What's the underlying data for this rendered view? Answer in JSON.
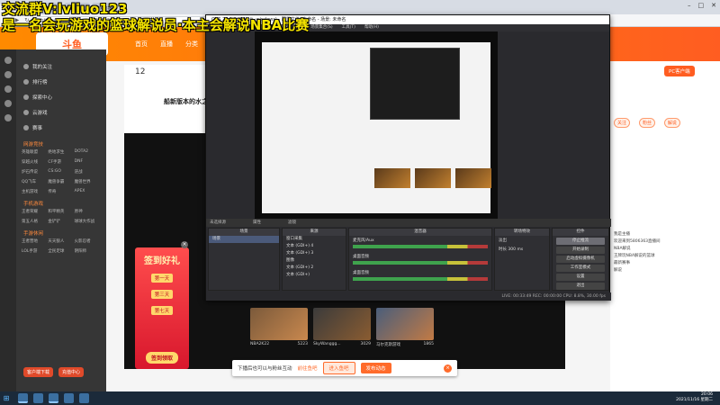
{
  "browser": {
    "tabs": [
      "斗鱼直播",
      "OBS 26.1.1 (64-bit, windows) - 配置文件: 未命名 - 场景: 未命名",
      "NBA2K22",
      "2K篮球",
      "2K直播"
    ],
    "url": "https://www.douyu.com/5806363"
  },
  "overlay": {
    "line1": "交流群V:lvliuo123",
    "line2": "是一名会玩游戏的篮球解说员·本主会解说NBA比赛"
  },
  "header": {
    "logo": "斗鱼",
    "nav": [
      "首页",
      "直播",
      "分类",
      "游戏",
      "鱼吧"
    ],
    "pc_button": "PC客户端"
  },
  "sidebar": {
    "items": [
      "我的关注",
      "排行榜",
      "探索中心",
      "云游戏",
      "赛事"
    ],
    "sec_hot": "网游竞技",
    "hot_games": [
      "英雄联盟",
      "绝地求生",
      "DOTA2",
      "穿越火线",
      "CF手游",
      "DNF",
      "炉石传说",
      "CS:GO",
      "逆战",
      "QQ飞车",
      "魔兽争霸",
      "魔兽世界",
      "主机游戏",
      "传奇",
      "APEX"
    ],
    "sec_mobile": "手机游戏",
    "mobile_games": [
      "王者荣耀",
      "和平精英",
      "原神",
      "第五人格",
      "金铲铲",
      "球球大作战"
    ],
    "sec_fun": "手游休闲",
    "fun_games": [
      "王者营地",
      "天天狼人",
      "火影忍者",
      "LOL手游",
      "全民足球",
      "阴阳师"
    ],
    "btn_client": "客户端下载",
    "btn_recharge": "充值中心"
  },
  "room": {
    "fans": "12",
    "name": "船新版本的水之"
  },
  "promo": {
    "title": "签到好礼",
    "day1": "第一天",
    "day2": "第三天",
    "day3": "第七天",
    "button": "签到领取",
    "close": "×"
  },
  "thumbs": [
    {
      "title": "NBA2K22",
      "views": "5223"
    },
    {
      "title": "SkyWanggg...",
      "views": "3029"
    },
    {
      "title": "马尔克斯游戏",
      "views": "1865"
    }
  ],
  "toast": {
    "text": "下播后也可以与粉丝互动",
    "link": "前往鱼吧",
    "btn1": "进入鱼吧",
    "btn2": "发布动态",
    "close": "×"
  },
  "right_panel": {
    "lines": [
      "我是主播",
      "欢迎来到5806363直播间",
      "NBA解说",
      "王牌玩NBA解说的篮球",
      "最新赛事",
      "解说"
    ],
    "btns": [
      "关注",
      "粉丝",
      "解说"
    ]
  },
  "obs": {
    "title": "OBS 26.1.1 (64-bit, windows) - 配置文件: 未命名 - 场景: 未命名",
    "menu": [
      "文件(F)",
      "编辑(E)",
      "视图(V)",
      "配置文件(P)",
      "场景集合(S)",
      "工具(T)",
      "帮助(H)"
    ],
    "label_bar": [
      "未选择源",
      "属性",
      "滤镜"
    ],
    "panels": {
      "scenes_h": "场景",
      "scene_row": "场景",
      "sources_h": "来源",
      "sources": [
        "窗口采集",
        "文本 (GDI+) 4",
        "文本 (GDI+) 3",
        "图像",
        "文本 (GDI+) 2",
        "文本 (GDI+)"
      ],
      "mixer_h": "混音器",
      "mix1": "麦克风/Aux",
      "mix2": "桌面音频",
      "mix3": "桌面音频",
      "trans_h": "转场特效",
      "trans_val": "淡出",
      "duration": "时长 300 ms",
      "ctrl_h": "控件",
      "controls": [
        "停止推流",
        "开始录制",
        "启动虚拟摄像机",
        "工作室模式",
        "设置",
        "退出"
      ]
    },
    "status": "LIVE: 00:33:49   REC: 00:00:00   CPU: 8.8%, 30.00 fps"
  },
  "taskbar": {
    "time": "20:06",
    "date": "2021/11/16 星期二"
  }
}
